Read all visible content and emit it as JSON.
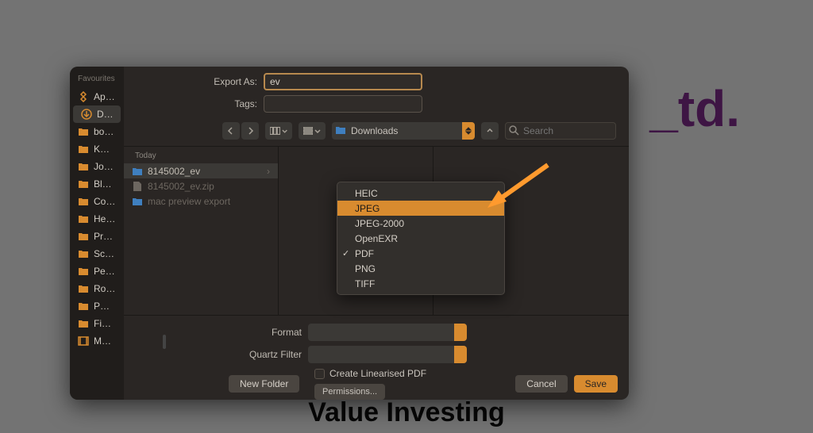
{
  "background": {
    "right_text": "_td.",
    "bottom_text": "Value Investing"
  },
  "dialog": {
    "sidebar_header": "Favourites",
    "sidebar": [
      {
        "label": "Applications",
        "icon": "apps"
      },
      {
        "label": "Downloads",
        "icon": "down",
        "selected": true
      },
      {
        "label": "bodyfatcutter",
        "icon": "folder"
      },
      {
        "label": "Kwebby",
        "icon": "folder"
      },
      {
        "label": "Jokes",
        "icon": "folder"
      },
      {
        "label": "Blogs",
        "icon": "folder"
      },
      {
        "label": "Copyrocket…",
        "icon": "folder"
      },
      {
        "label": "HealthyTum…",
        "icon": "folder"
      },
      {
        "label": "Presell Pages",
        "icon": "folder"
      },
      {
        "label": "Scripts",
        "icon": "folder"
      },
      {
        "label": "Personal Do…",
        "icon": "folder"
      },
      {
        "label": "RocketWeb…",
        "icon": "folder"
      },
      {
        "label": "PDF Chrom…",
        "icon": "folder"
      },
      {
        "label": "Final Inter",
        "icon": "folder"
      },
      {
        "label": "Movies",
        "icon": "movie"
      }
    ],
    "export_as_label": "Export As:",
    "export_as_value": "ev",
    "tags_label": "Tags:",
    "tags_value": "",
    "location_label": "Downloads",
    "search_placeholder": "Search",
    "column_header": "Today",
    "rows": [
      {
        "label": "8145002_ev",
        "icon": "folder",
        "selected": true,
        "has_children": true
      },
      {
        "label": "8145002_ev.zip",
        "icon": "file",
        "dim": true
      },
      {
        "label": "mac preview export",
        "icon": "folder",
        "dim": true
      }
    ],
    "format_label": "Format",
    "quartz_label": "Quartz Filter",
    "linearised_label": "Create Linearised PDF",
    "permissions_label": "Permissions...",
    "new_folder_label": "New Folder",
    "cancel_label": "Cancel",
    "save_label": "Save"
  },
  "dropdown": {
    "items": [
      {
        "label": "HEIC"
      },
      {
        "label": "JPEG",
        "highlighted": true
      },
      {
        "label": "JPEG-2000"
      },
      {
        "label": "OpenEXR"
      },
      {
        "label": "PDF",
        "checked": true
      },
      {
        "label": "PNG"
      },
      {
        "label": "TIFF"
      }
    ]
  }
}
